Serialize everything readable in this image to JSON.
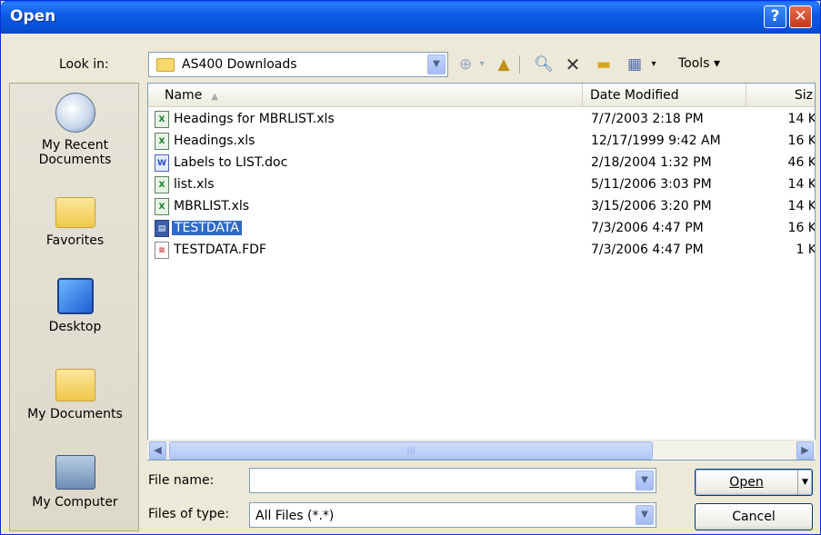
{
  "window": {
    "title": "Open",
    "help_label": "?",
    "close_label": "✕"
  },
  "lookin": {
    "label": "Look in:",
    "value": "AS400 Downloads"
  },
  "toolbar": {
    "tools_label": "Tools ▾",
    "icons": [
      "back-icon",
      "up-folder-icon",
      "search-web-icon",
      "delete-icon",
      "new-folder-icon",
      "views-icon"
    ]
  },
  "places": [
    {
      "label": "My Recent Documents",
      "icon": "recent-docs-icon"
    },
    {
      "label": "Favorites",
      "icon": "favorites-icon"
    },
    {
      "label": "Desktop",
      "icon": "desktop-icon"
    },
    {
      "label": "My Documents",
      "icon": "my-documents-icon"
    },
    {
      "label": "My Computer",
      "icon": "my-computer-icon"
    }
  ],
  "columns": {
    "name": "Name",
    "date": "Date Modified",
    "size": "Siz"
  },
  "files": [
    {
      "name": "Headings for MBRLIST.xls",
      "date": "7/7/2003 2:18 PM",
      "size": "14 K",
      "type": "xls"
    },
    {
      "name": "Headings.xls",
      "date": "12/17/1999 9:42 AM",
      "size": "16 K",
      "type": "xls"
    },
    {
      "name": "Labels to LIST.doc",
      "date": "2/18/2004 1:32 PM",
      "size": "46 K",
      "type": "doc"
    },
    {
      "name": "list.xls",
      "date": "5/11/2006 3:03 PM",
      "size": "14 K",
      "type": "xls"
    },
    {
      "name": "MBRLIST.xls",
      "date": "3/15/2006 3:20 PM",
      "size": "14 K",
      "type": "xls"
    },
    {
      "name": "TESTDATA",
      "date": "7/3/2006 4:47 PM",
      "size": "16 K",
      "type": "db",
      "selected": true
    },
    {
      "name": "TESTDATA.FDF",
      "date": "7/3/2006 4:47 PM",
      "size": "1 K",
      "type": "fdf"
    }
  ],
  "filename": {
    "label": "File name:",
    "value": ""
  },
  "filetype": {
    "label": "Files of type:",
    "value": "All Files (*.*)"
  },
  "buttons": {
    "open": "Open",
    "cancel": "Cancel"
  },
  "colors": {
    "titlebar": "#0a5ef0",
    "selection": "#316ac5",
    "dialog_bg": "#ece9d8"
  }
}
